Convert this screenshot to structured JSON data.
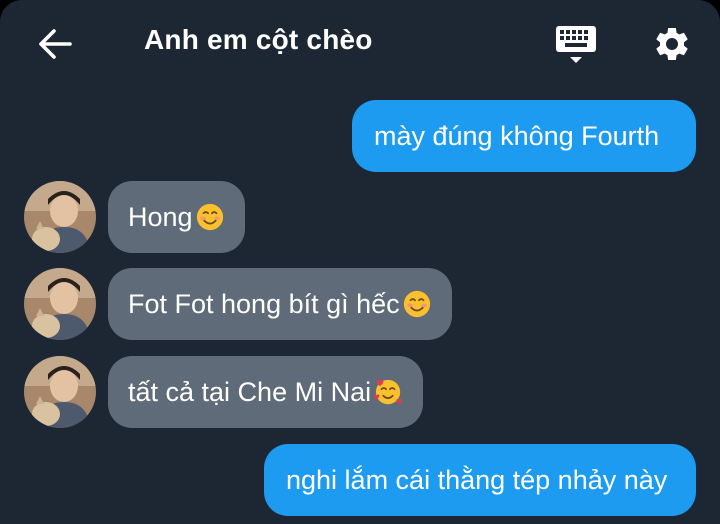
{
  "header": {
    "title": "Anh em cột chèo",
    "back_icon": "arrow-left-icon",
    "keyboard_icon": "keyboard-icon",
    "settings_icon": "gear-icon"
  },
  "colors": {
    "background": "#1d2733",
    "outgoing_bubble": "#1d9bf0",
    "incoming_bubble": "#5f6b78",
    "text": "#ffffff"
  },
  "messages": [
    {
      "direction": "outgoing",
      "text": "mày đúng không Fourth"
    },
    {
      "direction": "incoming",
      "text": "Hong",
      "emoji": "smiling-face-icon"
    },
    {
      "direction": "incoming",
      "text": "Fot Fot hong bít gì hếc",
      "emoji": "smiling-face-icon"
    },
    {
      "direction": "incoming",
      "text": "tất cả tại Che Mi Nai",
      "emoji": "smiling-face-with-hearts-icon"
    },
    {
      "direction": "outgoing",
      "text": "nghi lắm cái thằng tép nhảy này"
    }
  ]
}
